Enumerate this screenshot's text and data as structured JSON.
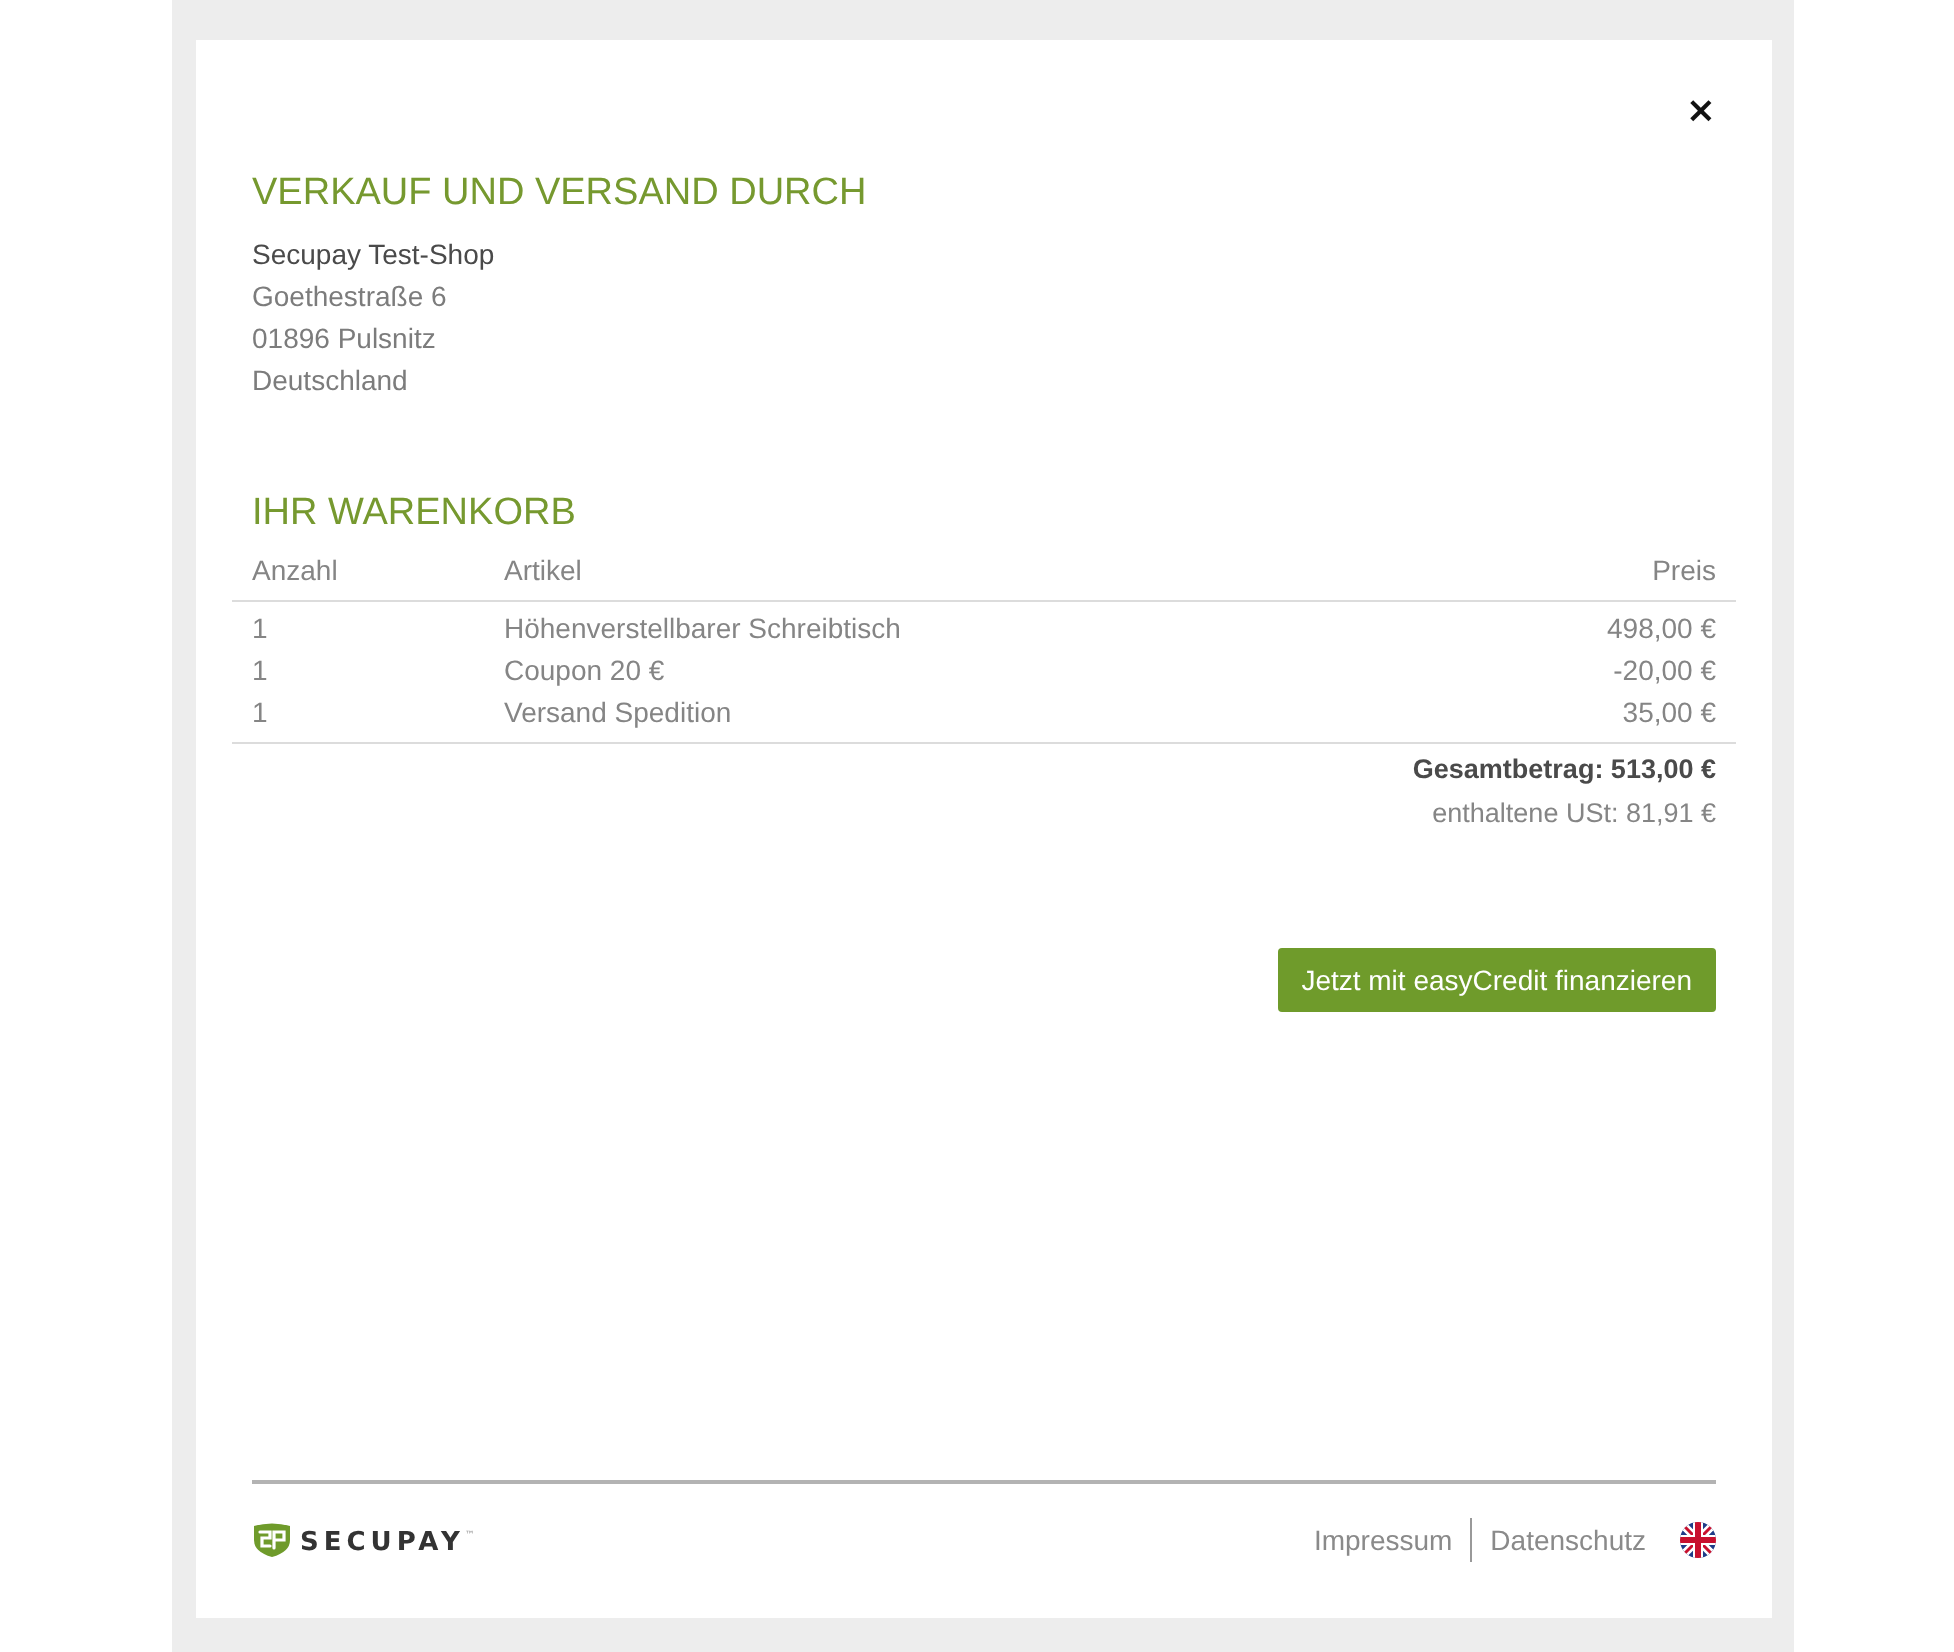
{
  "close_button": {
    "label": "×"
  },
  "seller": {
    "heading": "VERKAUF UND VERSAND DURCH",
    "name": "Secupay Test-Shop",
    "address_lines": [
      "Goethestraße 6",
      "01896 Pulsnitz",
      "Deutschland"
    ]
  },
  "cart": {
    "heading": "IHR WARENKORB",
    "columns": [
      "Anzahl",
      "Artikel",
      "Preis"
    ],
    "rows": [
      {
        "quantity": "1",
        "item": "Höhenverstellbarer Schreibtisch",
        "price": "498,00 €"
      },
      {
        "quantity": "1",
        "item": "Coupon 20 €",
        "price": "-20,00 €"
      },
      {
        "quantity": "1",
        "item": "Versand Spedition",
        "price": "35,00 €"
      }
    ],
    "total": "Gesamtbetrag: 513,00 €",
    "vat": "enthaltene USt: 81,91 €"
  },
  "finance_button": {
    "label": "Jetzt mit easyCredit finanzieren"
  },
  "footer": {
    "logo": "SECUPAY$^{™}$",
    "links": [
      "Impressum",
      "Datenschutz"
    ]
  }
}
